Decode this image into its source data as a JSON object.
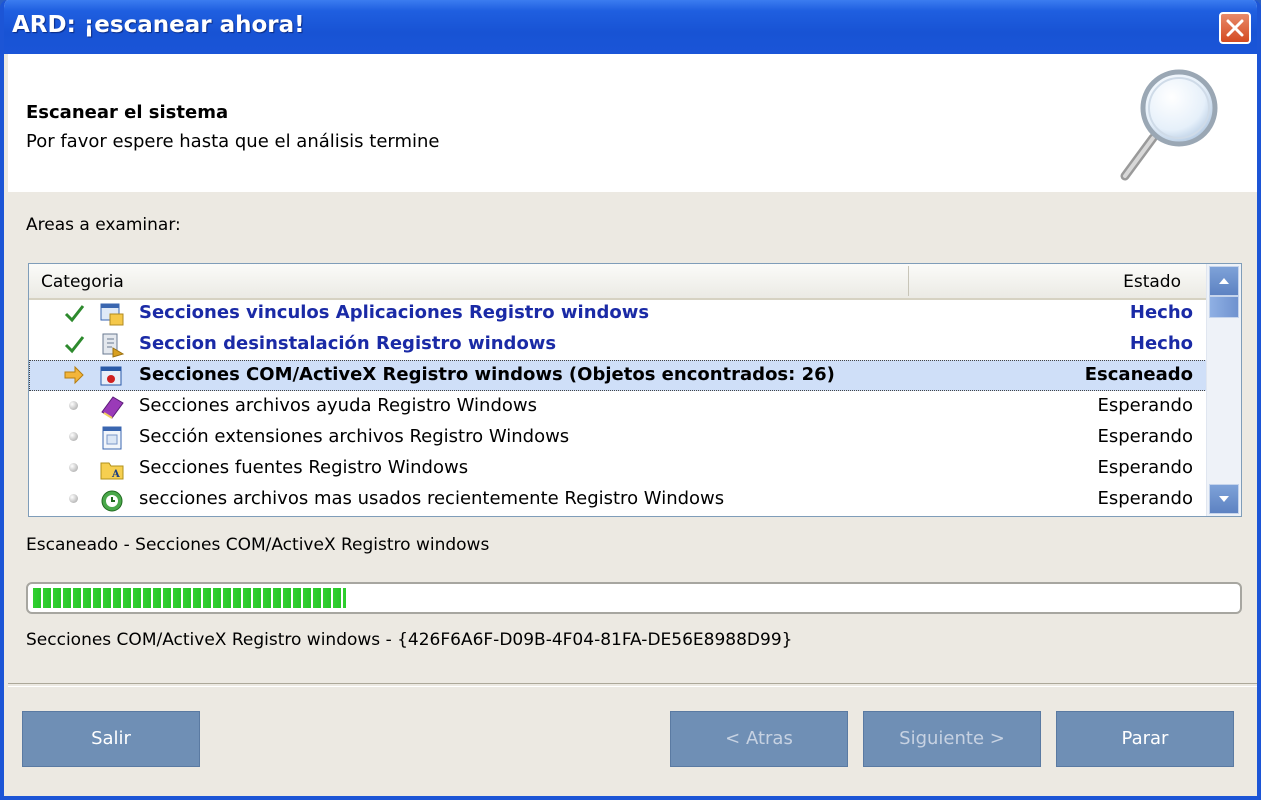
{
  "window": {
    "title": "ARD: ¡escanear ahora!"
  },
  "header": {
    "title": "Escanear el sistema",
    "subtitle": "Por favor espere hasta que el análisis termine",
    "icon": "magnifier-icon"
  },
  "areas_label": "Areas a examinar:",
  "list": {
    "columns": {
      "category": "Categoria",
      "state": "Estado"
    },
    "rows": [
      {
        "label": "Secciones vinculos Aplicaciones Registro windows",
        "state": "Hecho",
        "status_icon": "checkmark-icon",
        "category_icon": "application-links-icon"
      },
      {
        "label": "Seccion desinstalación Registro windows",
        "state": "Hecho",
        "status_icon": "checkmark-icon",
        "category_icon": "uninstall-icon"
      },
      {
        "label": "Secciones COM/ActiveX Registro windows (Objetos encontrados: 26)",
        "state": "Escaneado",
        "status_icon": "arrow-right-icon",
        "category_icon": "activex-icon"
      },
      {
        "label": "Secciones archivos ayuda Registro Windows",
        "state": "Esperando",
        "status_icon": "pending-dot-icon",
        "category_icon": "help-book-icon"
      },
      {
        "label": "Sección extensiones archivos Registro Windows",
        "state": "Esperando",
        "status_icon": "pending-dot-icon",
        "category_icon": "file-extension-icon"
      },
      {
        "label": "Secciones fuentes Registro Windows",
        "state": "Esperando",
        "status_icon": "pending-dot-icon",
        "category_icon": "fonts-folder-icon"
      },
      {
        "label": "secciones archivos mas usados recientemente Registro Windows",
        "state": "Esperando",
        "status_icon": "pending-dot-icon",
        "category_icon": "recent-files-icon"
      }
    ]
  },
  "status_text": "Escaneado - Secciones COM/ActiveX Registro windows",
  "progress": {
    "fraction": 0.26
  },
  "detail_text": "Secciones COM/ActiveX Registro windows - {426F6A6F-D09B-4F04-81FA-DE56E8988D99}",
  "buttons": {
    "exit": "Salir",
    "back": "< Atras",
    "next": "Siguiente >",
    "stop": "Parar"
  },
  "colors": {
    "title_bar": "#1853d4",
    "done_text": "#1a2aa6",
    "progress": "#2fd12f",
    "button": "#6f8fb5"
  }
}
